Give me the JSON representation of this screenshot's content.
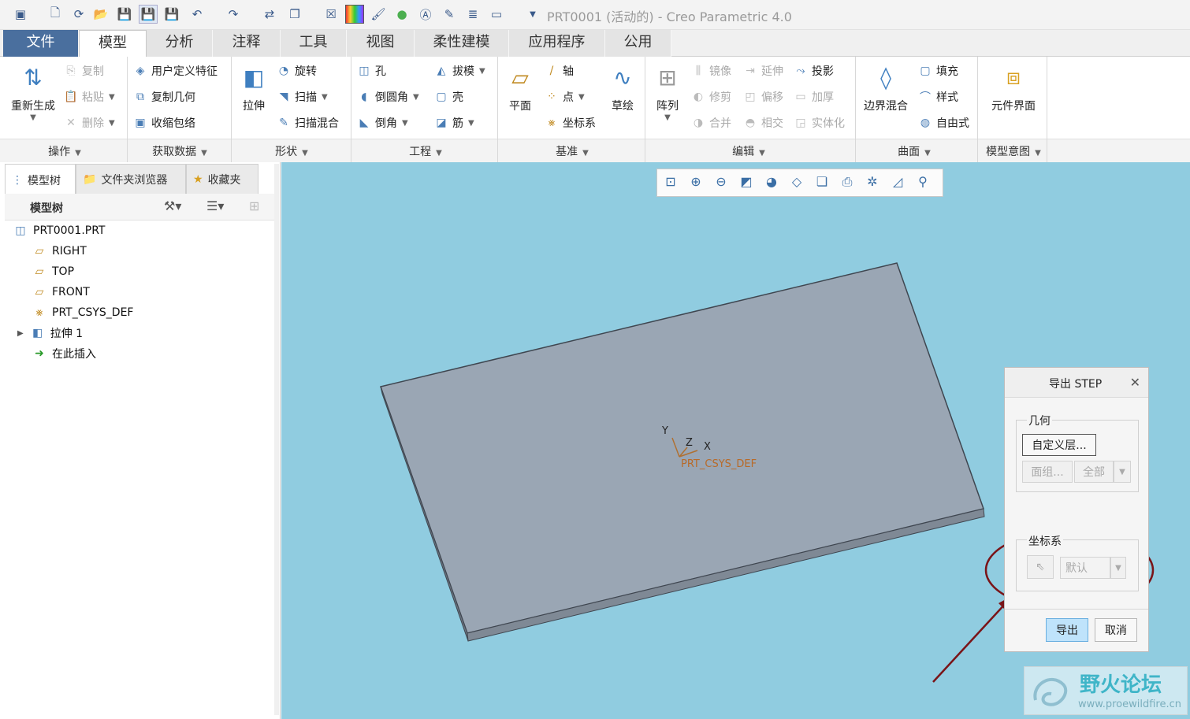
{
  "title": "PRT0001 (活动的) - Creo Parametric 4.0",
  "tabs": [
    "文件",
    "模型",
    "分析",
    "注释",
    "工具",
    "视图",
    "柔性建模",
    "应用程序",
    "公用"
  ],
  "groups": {
    "ops": {
      "label": "操作",
      "regen": "重新生成",
      "copy": "复制",
      "paste": "粘贴",
      "delete": "删除"
    },
    "getdata": {
      "label": "获取数据",
      "udf": "用户定义特征",
      "copygeom": "复制几何",
      "shrink": "收缩包络"
    },
    "shape": {
      "label": "形状",
      "extrude": "拉伸",
      "revolve": "旋转",
      "sweep": "扫描",
      "sweepblend": "扫描混合"
    },
    "eng": {
      "label": "工程",
      "hole": "孔",
      "round": "倒圆角",
      "chamfer": "倒角",
      "draft": "拔模",
      "shell": "壳",
      "rib": "筋"
    },
    "datum": {
      "label": "基准",
      "plane": "平面",
      "axis": "轴",
      "point": "点",
      "csys": "坐标系",
      "sketch": "草绘"
    },
    "edit": {
      "label": "编辑",
      "pattern": "阵列",
      "mirror": "镜像",
      "extend": "延伸",
      "project": "投影",
      "trim": "修剪",
      "offset": "偏移",
      "thicken": "加厚",
      "merge": "合并",
      "intersect": "相交",
      "solidify": "实体化"
    },
    "surface": {
      "label": "曲面",
      "boundary": "边界混合",
      "fill": "填充",
      "style": "样式",
      "freestyle": "自由式"
    },
    "intent": {
      "label": "模型意图",
      "component": "元件界面"
    }
  },
  "left_tabs": [
    "模型树",
    "文件夹浏览器",
    "收藏夹"
  ],
  "tree": {
    "header": "模型树",
    "items": [
      "PRT0001.PRT",
      "RIGHT",
      "TOP",
      "FRONT",
      "PRT_CSYS_DEF",
      "拉伸 1",
      "在此插入"
    ]
  },
  "model": {
    "csys_label": "PRT_CSYS_DEF",
    "axis_x": "X",
    "axis_y": "Y",
    "axis_z": "Z"
  },
  "dialog": {
    "title": "导出 STEP",
    "geometry_label": "几何",
    "custom_layer": "自定义层...",
    "face_group": "面组...",
    "all": "全部",
    "csys_label": "坐标系",
    "default": "默认",
    "export": "导出",
    "cancel": "取消"
  },
  "watermark": {
    "title": "野火论坛",
    "url": "www.proewildfire.cn"
  },
  "colors": {
    "viewport": "#90cce0",
    "part": "#9aa6b4",
    "annotation": "#7a1418",
    "file_tab": "#4a6f9e"
  }
}
